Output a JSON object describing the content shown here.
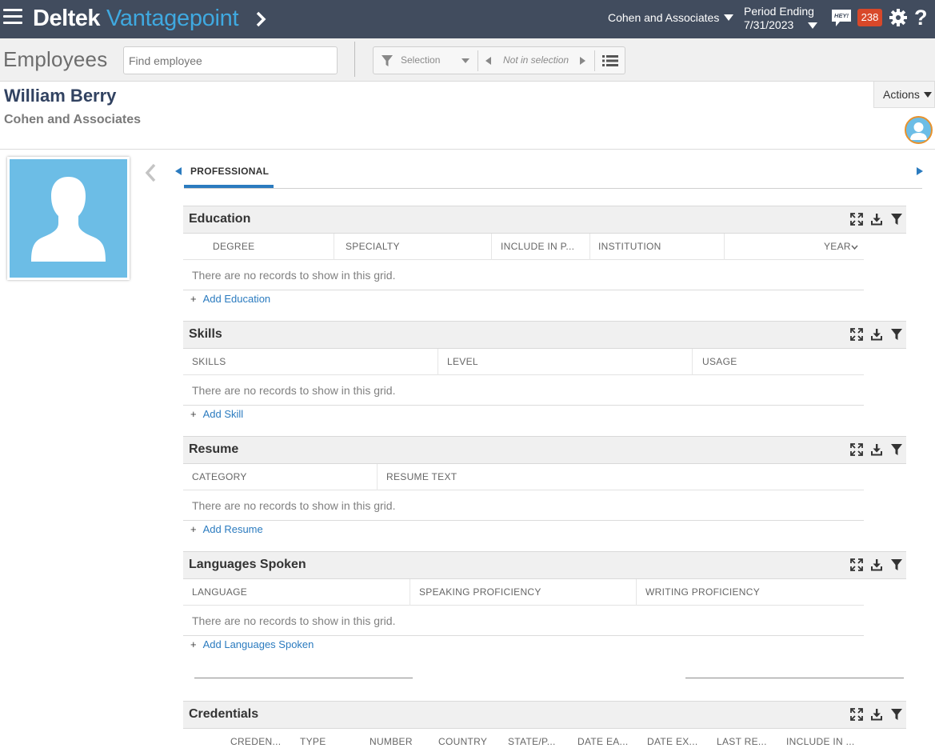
{
  "topbar": {
    "brand_main": "Deltek",
    "brand_sub": "Vantagepoint",
    "company": "Cohen and Associates",
    "period_label": "Period Ending",
    "period_date": "7/31/2023",
    "hey_label": "HEY!",
    "notification_count": "238",
    "help_label": "?"
  },
  "subbar": {
    "title": "Employees",
    "search_placeholder": "Find employee",
    "selection_label": "Selection",
    "not_in_selection_label": "Not in selection"
  },
  "record": {
    "name": "William Berry",
    "company": "Cohen and Associates",
    "actions_label": "Actions"
  },
  "tabs": {
    "active": "PROFESSIONAL"
  },
  "grids": {
    "empty_text": "There are no records to show in this grid.",
    "education": {
      "title": "Education",
      "columns": [
        "DEGREE",
        "SPECIALTY",
        "INCLUDE IN P...",
        "INSTITUTION",
        "YEAR"
      ],
      "add_label": "Add Education"
    },
    "skills": {
      "title": "Skills",
      "columns": [
        "SKILLS",
        "LEVEL",
        "USAGE"
      ],
      "add_label": "Add Skill"
    },
    "resume": {
      "title": "Resume",
      "columns": [
        "CATEGORY",
        "RESUME TEXT"
      ],
      "add_label": "Add Resume"
    },
    "languages": {
      "title": "Languages Spoken",
      "columns": [
        "LANGUAGE",
        "SPEAKING PROFICIENCY",
        "WRITING PROFICIENCY"
      ],
      "add_label": "Add Languages Spoken"
    },
    "credentials": {
      "title": "Credentials",
      "columns": [
        "CREDEN...",
        "TYPE",
        "NUMBER",
        "COUNTRY",
        "STATE/P...",
        "DATE EA...",
        "DATE EX...",
        "LAST RE...",
        "INCLUDE IN ..."
      ]
    }
  },
  "colors": {
    "topbar_bg": "#414c5e",
    "brand_accent": "#3fa9e0",
    "link_blue": "#2b7bbf",
    "badge_red": "#d8482a",
    "avatar_blue": "#6cbde6",
    "avatar_ring": "#e8922d"
  }
}
